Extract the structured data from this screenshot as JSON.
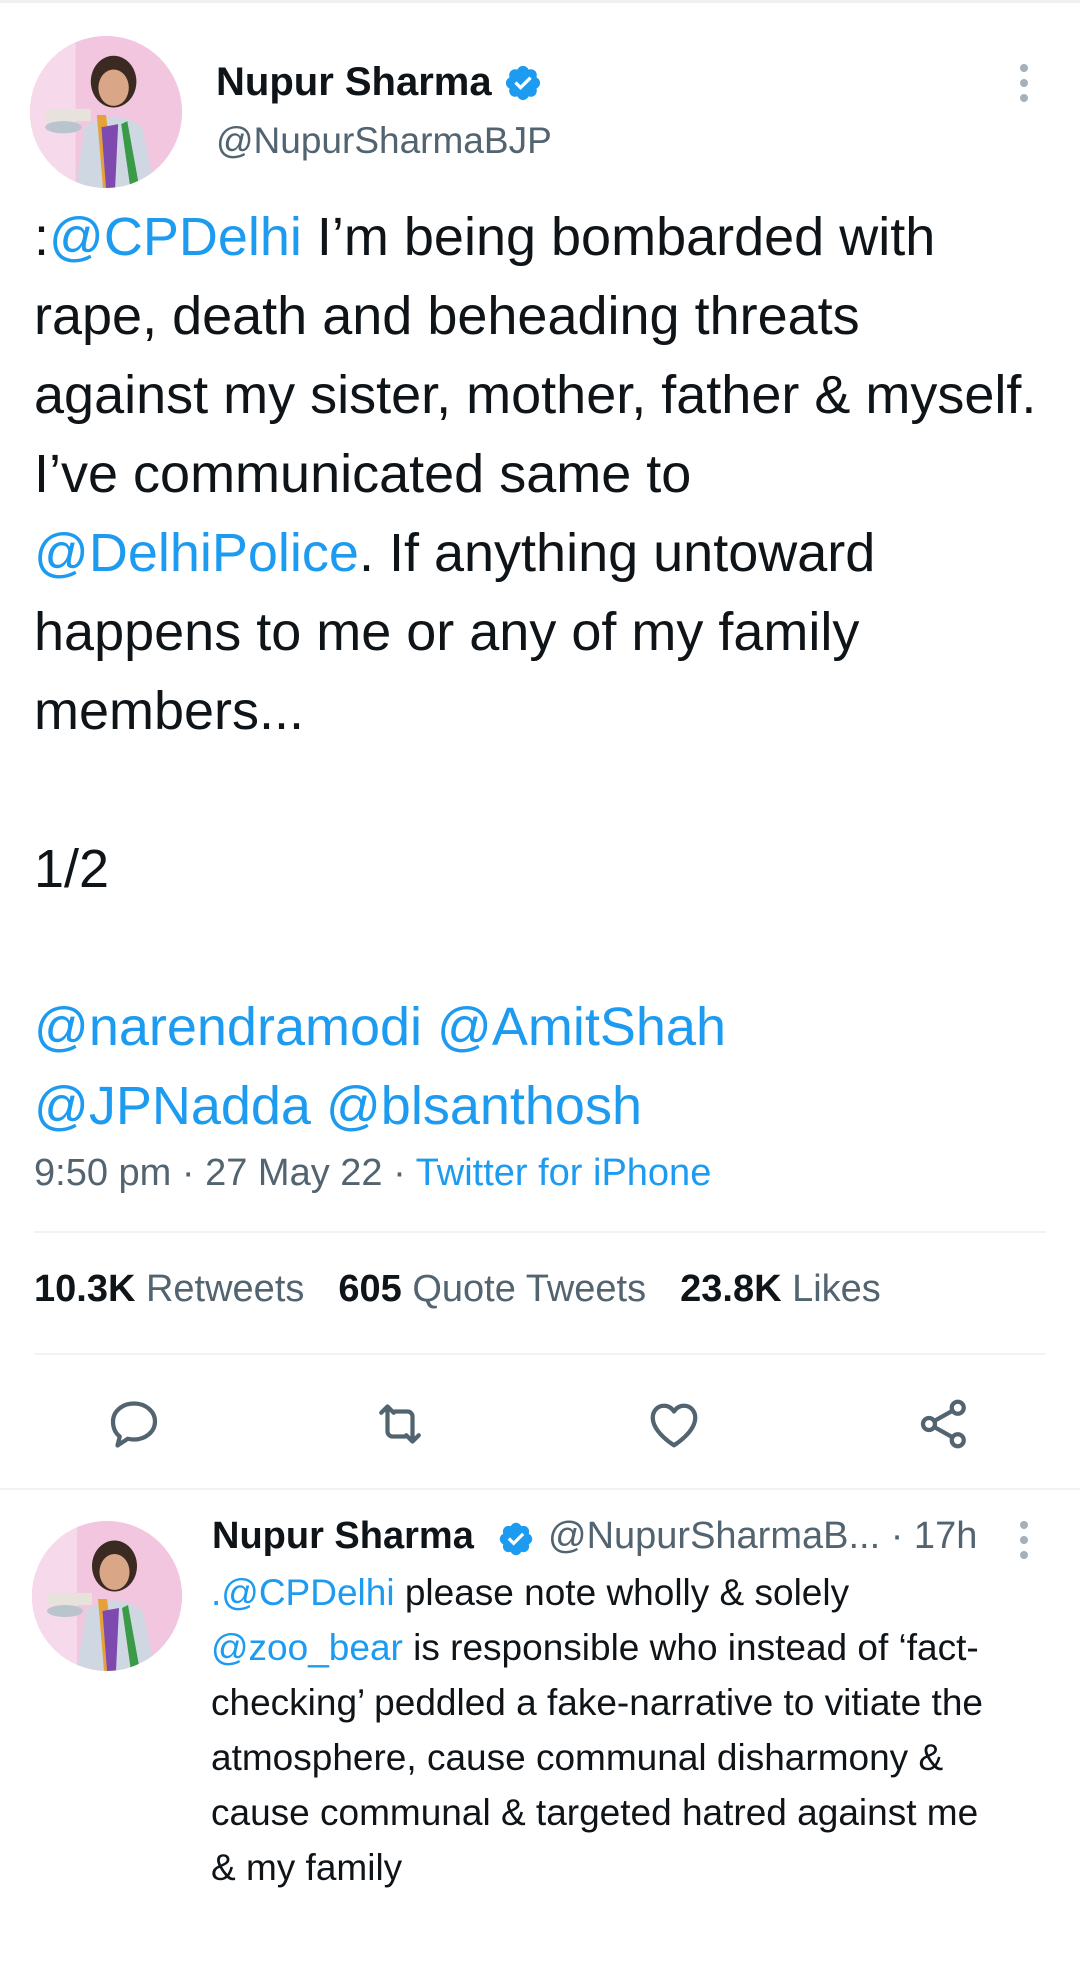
{
  "colors": {
    "link": "#1d9bf0",
    "secondary": "#536471",
    "text": "#0f1419",
    "verified": "#1d9bf0"
  },
  "tweet": {
    "author_name": "Nupur Sharma",
    "author_handle": "@NupurSharmaBJP",
    "text_prefix": ":",
    "mention_cp": "@CPDelhi",
    "text_part1": " I’m being bombarded with rape, death and beheading threats against my sister, mother, father & myself. I’ve communicated same to ",
    "mention_police": "@DelhiPolice",
    "text_part2": ". If anything untoward happens to me or any of my family members...",
    "counter": "1/2",
    "mention_modi": "@narendramodi",
    "mention_shah": "@AmitShah",
    "mention_nadda": "@JPNadda",
    "mention_santhosh": "@blsanthosh",
    "time": "9:50 pm",
    "separator": " · ",
    "date": "27 May 22",
    "source": "Twitter for iPhone"
  },
  "stats": {
    "retweets_count": "10.3K",
    "retweets_label": "Retweets",
    "quotes_count": "605",
    "quotes_label": "Quote Tweets",
    "likes_count": "23.8K",
    "likes_label": "Likes"
  },
  "actions": [
    "reply-icon",
    "retweet-icon",
    "like-icon",
    "share-icon"
  ],
  "reply": {
    "author_name": "Nupur Sharma",
    "author_handle": "@NupurSharmaB...",
    "time": "· 17h",
    "mention_cp": ".@CPDelhi",
    "text_part1": " please note wholly & solely ",
    "mention_zoo": "@zoo_bear",
    "text_part2": " is responsible who instead of ‘fact-checking’ peddled a fake-narrative to vitiate the atmosphere, cause communal disharmony & cause communal & targeted hatred against me & my family"
  }
}
